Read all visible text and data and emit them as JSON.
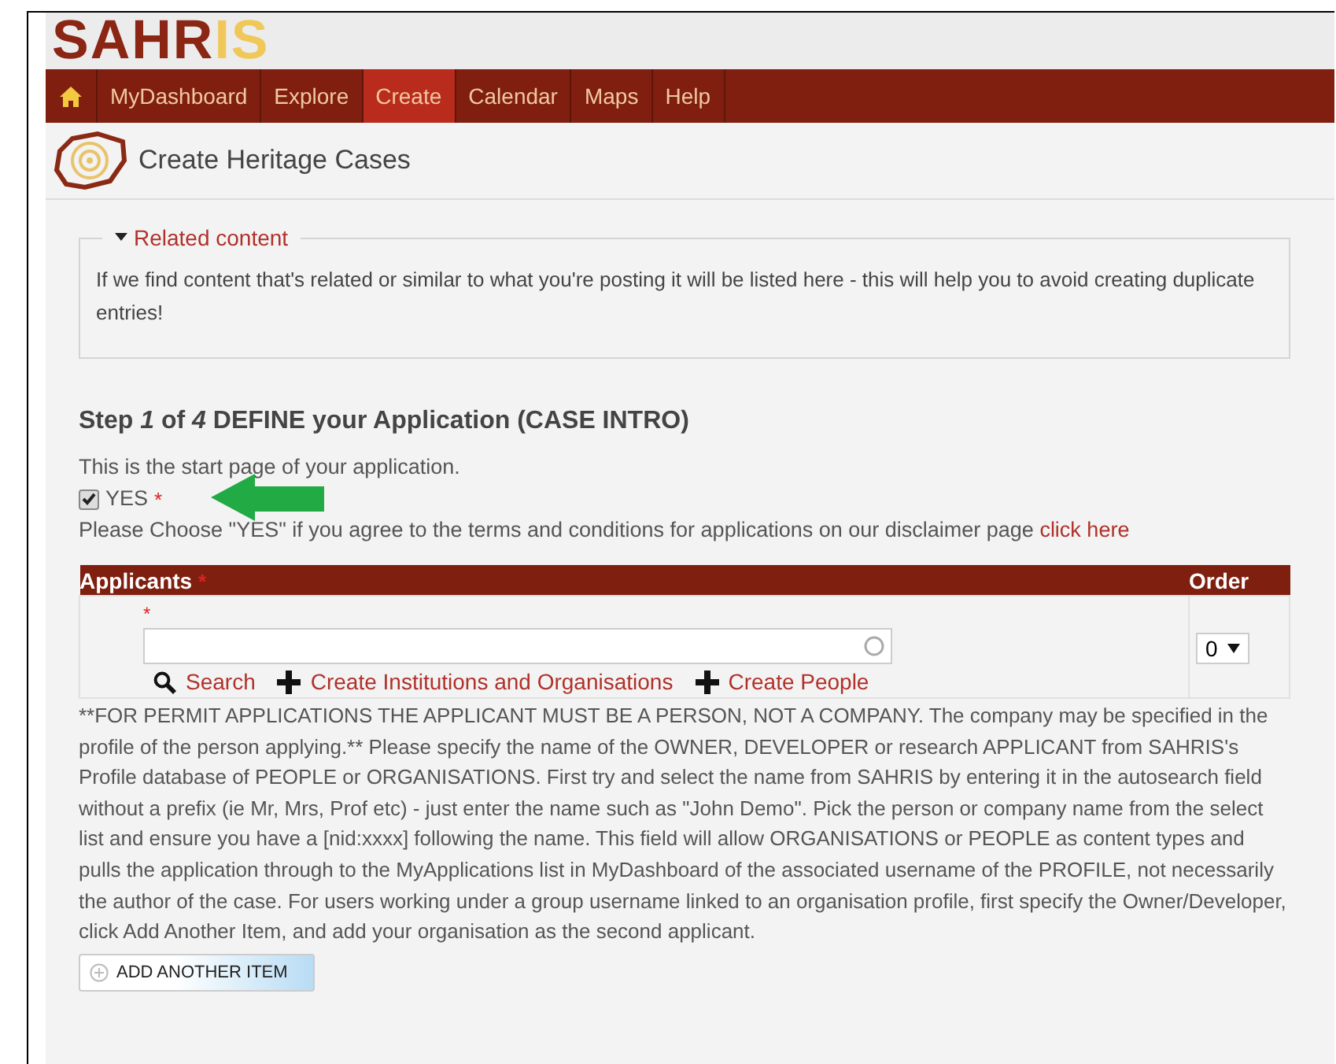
{
  "logo": [
    {
      "text": "SAHR",
      "kind": "primary"
    },
    {
      "text": "IS",
      "kind": "accent"
    }
  ],
  "nav": [
    {
      "kind": "home",
      "selected": false
    },
    {
      "kind": "text",
      "label": "MyDashboard",
      "selected": false
    },
    {
      "kind": "text",
      "label": "Explore",
      "selected": false
    },
    {
      "kind": "text",
      "label": "Create",
      "selected": true
    },
    {
      "kind": "text",
      "label": "Calendar",
      "selected": false
    },
    {
      "kind": "text",
      "label": "Maps",
      "selected": false
    },
    {
      "kind": "text",
      "label": "Help",
      "selected": false
    }
  ],
  "page_title": "Create Heritage Cases",
  "related": {
    "legend": "Related content",
    "expanded": true,
    "text": "If we find content that's related or similar to what you're posting it will be listed here - this will help you to avoid creating duplicate entries!"
  },
  "step_heading": "Step *1* of *4* DEFINE your Application (CASE INTRO)",
  "intro": "This is the start page of your application.",
  "agree": {
    "label": "YES",
    "checked": true,
    "required_mark": "*"
  },
  "terms": {
    "text": "Please Choose \"YES\" if you agree to the terms and conditions for applications on our disclaimer page",
    "link": "click here"
  },
  "applicants": {
    "columns": [
      "Applicants",
      "Order"
    ],
    "required_mark": "*",
    "row": {
      "required_mark": "*",
      "order": "0"
    },
    "links": [
      {
        "kind": "search",
        "label": "Search"
      },
      {
        "kind": "add",
        "label": "Create Institutions and Organisations"
      },
      {
        "kind": "add",
        "label": "Create People"
      }
    ]
  },
  "help": "**FOR PERMIT APPLICATIONS THE APPLICANT MUST BE A PERSON, NOT A COMPANY. The company may be specified in the profile of the person applying.** Please specify the name of the OWNER, DEVELOPER or research APPLICANT from SAHRIS's Profile database of PEOPLE or ORGANISATIONS. First try and select the name from SAHRIS by entering it in the autosearch field without a prefix (ie Mr, Mrs, Prof etc) - just enter the name such as \"John Demo\". Pick the person or company name from the select list and ensure you have a [nid:xxxx] following the name. This field will allow ORGANISATIONS or PEOPLE as content types and pulls the application through to the MyApplications list in MyDashboard of the associated username of the PROFILE, not necessarily the author of the case. For users working under a group username linked to an organisation profile, first specify the Owner/Developer, click Add Another Item, and add your organisation as the second applicant.",
  "add_button": "ADD ANOTHER ITEM"
}
